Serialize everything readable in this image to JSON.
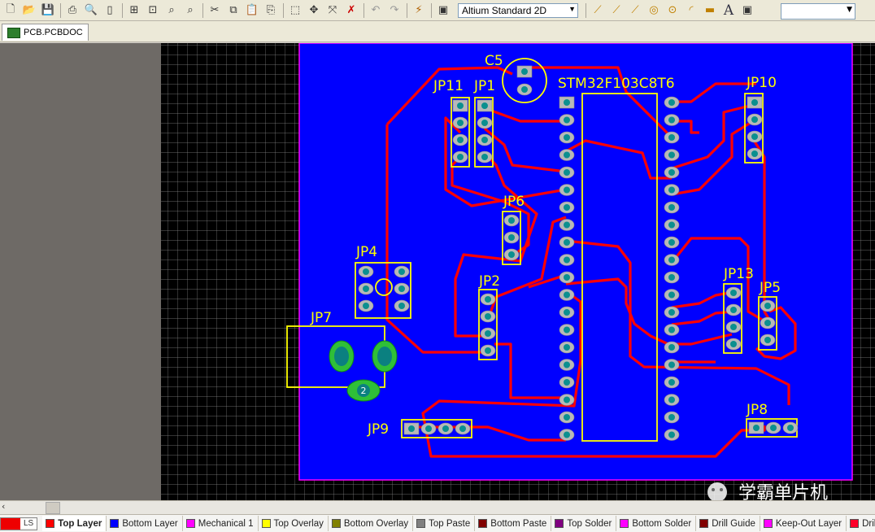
{
  "toolbar": {
    "view_mode": "Altium Standard 2D",
    "buttons": [
      "new-icon",
      "open-icon",
      "save-icon",
      "print-icon",
      "print-preview-icon",
      "page-icon",
      "zoom-fit-icon",
      "zoom-area-icon",
      "zoom-selected-icon",
      "zoom-filter-icon",
      "cut-icon",
      "copy-icon",
      "paste-icon",
      "rubber-stamp-icon",
      "select-rect-icon",
      "move-icon",
      "cross-select-icon",
      "clear-icon",
      "undo-icon",
      "redo-icon",
      "crossprobe-icon",
      "browse-icon"
    ],
    "place_buttons": [
      "interactive-route-icon",
      "differential-route-icon",
      "multi-route-icon",
      "place-via-icon",
      "place-pad-icon",
      "place-arc-icon",
      "place-fill-icon",
      "place-text-icon",
      "place-region-icon"
    ]
  },
  "document": {
    "tab_label": "PCB.PCBDOC"
  },
  "pcb": {
    "board_color": "#0000ff",
    "track_color": "#ff0000",
    "overlay_color": "#ffff00",
    "designators": [
      {
        "id": "c5",
        "text": "C5"
      },
      {
        "id": "jp11",
        "text": "JP11"
      },
      {
        "id": "jp1",
        "text": "JP1"
      },
      {
        "id": "mcu",
        "text": "STM32F103C8T6"
      },
      {
        "id": "jp10",
        "text": "JP10"
      },
      {
        "id": "jp6",
        "text": "JP6"
      },
      {
        "id": "jp4",
        "text": "JP4"
      },
      {
        "id": "jp2",
        "text": "JP2"
      },
      {
        "id": "jp7",
        "text": "JP7"
      },
      {
        "id": "jp13",
        "text": "JP13"
      },
      {
        "id": "jp5",
        "text": "JP5"
      },
      {
        "id": "jp8",
        "text": "JP8"
      },
      {
        "id": "jp9",
        "text": "JP9"
      }
    ],
    "jp7_pad_label": "2"
  },
  "watermark": {
    "text": "学霸单片机"
  },
  "layers": {
    "ls_label": "LS",
    "tabs": [
      {
        "name": "Top Layer",
        "color": "#ff0000",
        "active": true
      },
      {
        "name": "Bottom Layer",
        "color": "#0000ff"
      },
      {
        "name": "Mechanical 1",
        "color": "#ff00ff"
      },
      {
        "name": "Top Overlay",
        "color": "#ffff00"
      },
      {
        "name": "Bottom Overlay",
        "color": "#808000"
      },
      {
        "name": "Top Paste",
        "color": "#808080"
      },
      {
        "name": "Bottom Paste",
        "color": "#800000"
      },
      {
        "name": "Top Solder",
        "color": "#800080"
      },
      {
        "name": "Bottom Solder",
        "color": "#ff00ff"
      },
      {
        "name": "Drill Guide",
        "color": "#800000"
      },
      {
        "name": "Keep-Out Layer",
        "color": "#ff00ff"
      },
      {
        "name": "Drill Drawing",
        "color": "#ff002a"
      }
    ]
  }
}
